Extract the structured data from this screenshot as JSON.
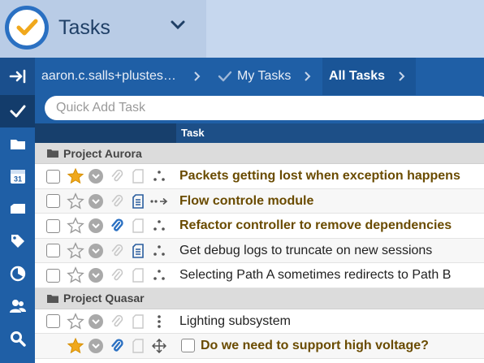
{
  "app": {
    "title": "Tasks"
  },
  "breadcrumb": {
    "account": "aaron.c.salls+plustes…",
    "my_tasks": "My Tasks",
    "all_tasks": "All Tasks"
  },
  "quick_add": {
    "placeholder": "Quick Add Task"
  },
  "columns": {
    "task": "Task"
  },
  "rail": [
    {
      "icon": "checkmark-icon",
      "active": true
    },
    {
      "icon": "folder-icon"
    },
    {
      "icon": "calendar-icon",
      "text": "31"
    },
    {
      "icon": "context-icon"
    },
    {
      "icon": "tag-icon"
    },
    {
      "icon": "status-icon"
    },
    {
      "icon": "people-icon"
    },
    {
      "icon": "search-icon"
    }
  ],
  "groups": [
    {
      "name": "Project Aurora",
      "tasks": [
        {
          "title": "Packets getting lost when exception happens",
          "starred": true,
          "clip": false,
          "note": false,
          "subtask_icon": "dots"
        },
        {
          "title": "Flow controle module",
          "starred": false,
          "clip": false,
          "note": true,
          "subtask_icon": "arrow"
        },
        {
          "title": "Refactor controller to remove dependencies",
          "starred": false,
          "clip": true,
          "note": false,
          "subtask_icon": "dots"
        },
        {
          "title": "Get debug logs to truncate on new sessions",
          "starred": false,
          "clip": false,
          "note": true,
          "subtask_icon": "dots"
        },
        {
          "title": "Selecting Path A sometimes redirects to Path B",
          "starred": false,
          "clip": false,
          "note": false,
          "subtask_icon": "dots"
        }
      ]
    },
    {
      "name": "Project Quasar",
      "tasks": [
        {
          "title": "Lighting subsystem",
          "starred": false,
          "clip": false,
          "note": false,
          "subtask_icon": "vdots"
        },
        {
          "title": "Do we need to support high voltage?",
          "starred": true,
          "clip": true,
          "note": false,
          "subtask_icon": "move",
          "is_subtask": true
        }
      ]
    }
  ],
  "colors": {
    "header_bg": "#c6d7ee",
    "bar_blue": "#1f5fa6",
    "star_gold": "#f0a81c",
    "clip_blue": "#2a70c2",
    "starred_text": "#6a4b00"
  }
}
